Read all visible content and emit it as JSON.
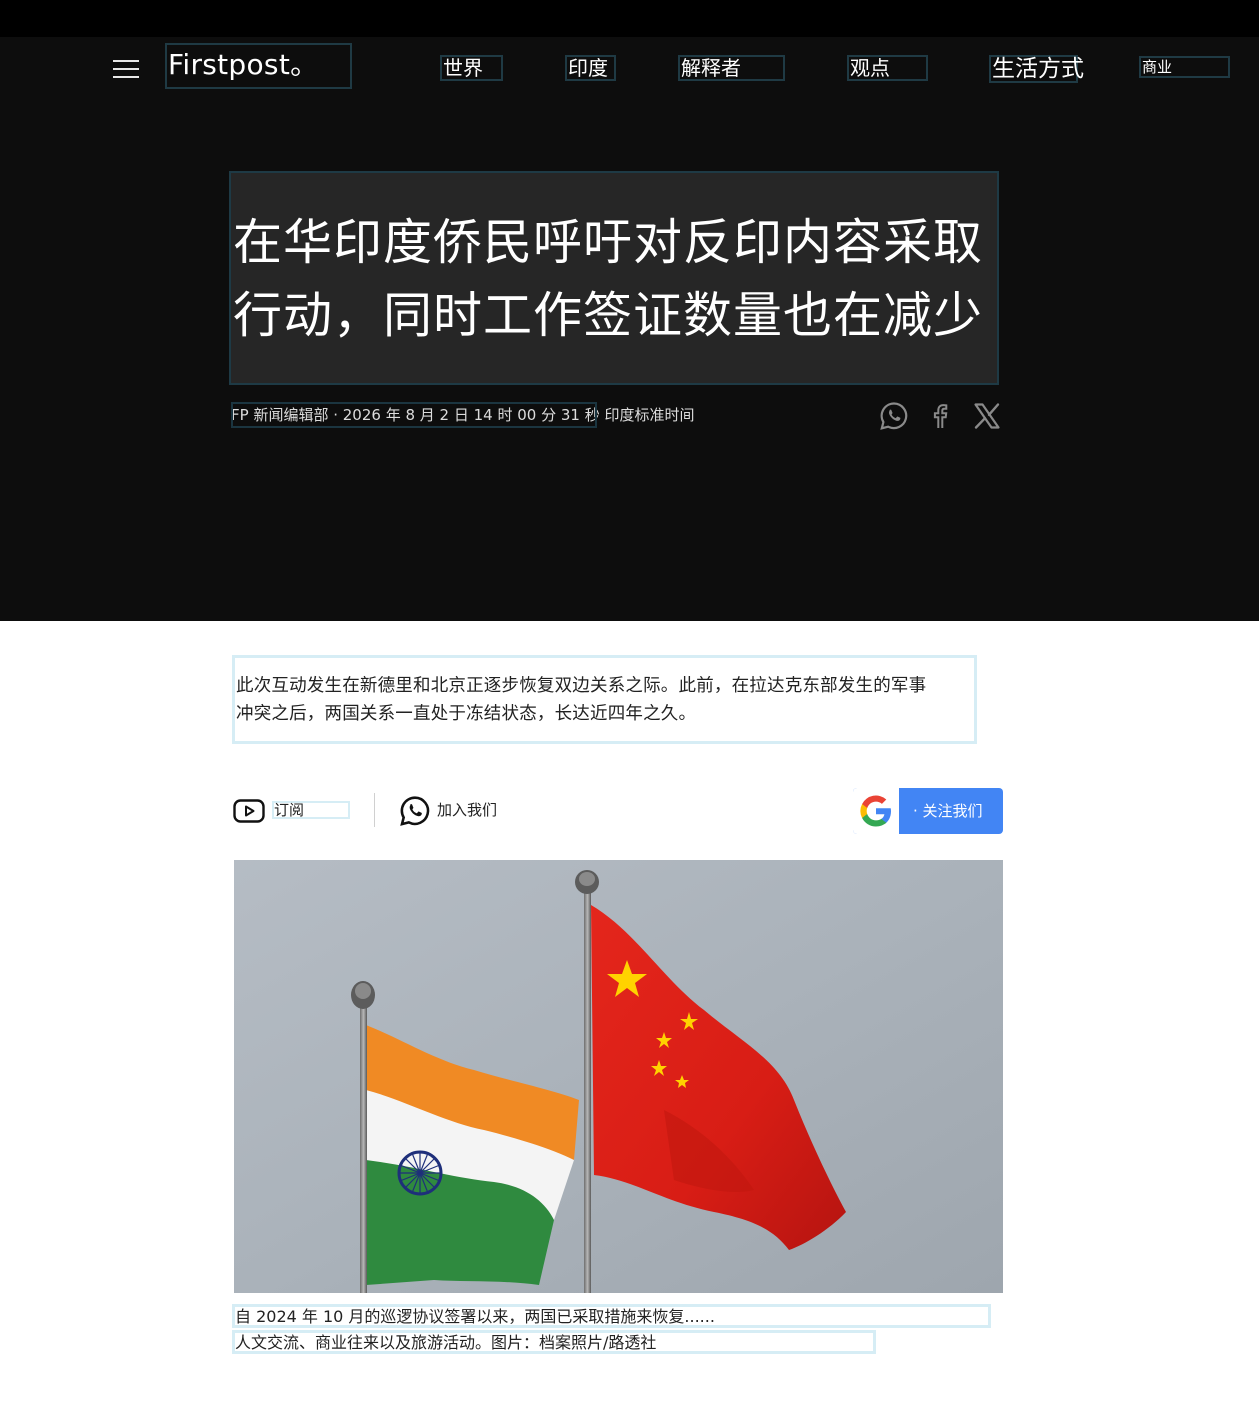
{
  "site": {
    "logo": "Firstpost。"
  },
  "nav": {
    "items": [
      {
        "label": "世界"
      },
      {
        "label": "印度"
      },
      {
        "label": "解释者"
      },
      {
        "label": "观点"
      },
      {
        "label": "生活方式"
      },
      {
        "label": "商业"
      }
    ]
  },
  "article": {
    "title_line1": "在华印度侨民呼吁对反印内容采取",
    "title_line2": "行动，同时工作签证数量也在减少",
    "byline": "FP 新闻编辑部 · 2026 年 8 月 2 日 14 时 00 分 31 秒 印度标准时间",
    "summary_line1": "此次互动发生在新德里和北京正逐步恢复双边关系之际。此前，在拉达克东部发生的军事",
    "summary_line2": "冲突之后，两国关系一直处于冻结状态，长达近四年之久。",
    "caption_line1": "自 2024 年 10 月的巡逻协议签署以来，两国已采取措施来恢复......",
    "caption_line2": "人文交流、商业往来以及旅游活动。图片：档案照片/路透社"
  },
  "actions": {
    "subscribe_label": "订阅",
    "join_label": "加入我们",
    "follow_label": "· 关注我们"
  },
  "share": {
    "icons": [
      "whatsapp-icon",
      "facebook-icon",
      "x-icon"
    ]
  },
  "colors": {
    "header_bg": "#0d0d0d",
    "title_box_bg": "#262626",
    "google_blue": "#4285f4"
  }
}
